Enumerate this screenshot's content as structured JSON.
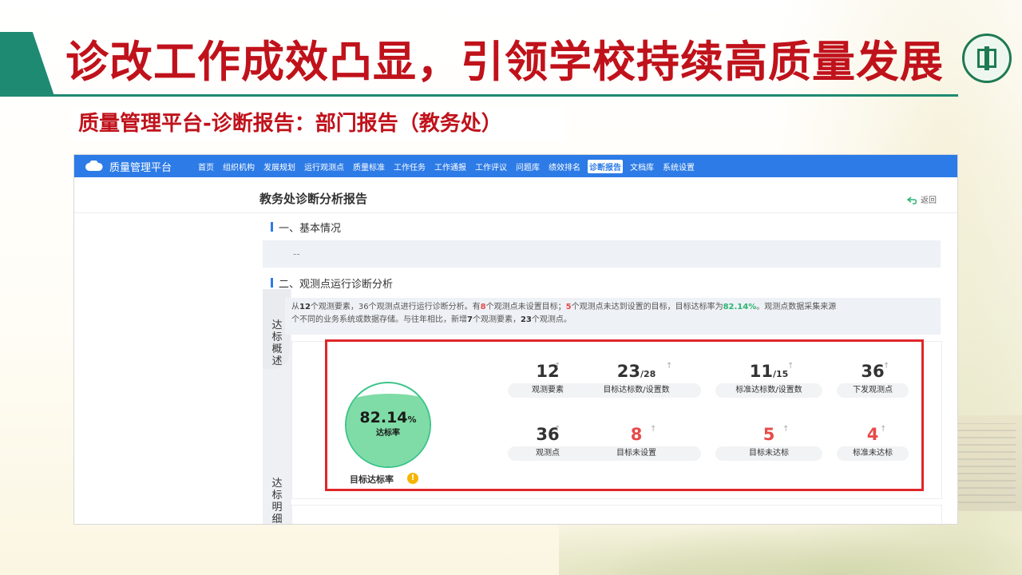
{
  "slide": {
    "title": "诊改工作成效凸显，引领学校持续高质量发展",
    "subtitle": "质量管理平台-诊断报告：部门报告（教务处）"
  },
  "app": {
    "brand": "质量管理平台",
    "nav": [
      "首页",
      "组织机构",
      "发展规划",
      "运行观测点",
      "质量标准",
      "工作任务",
      "工作通报",
      "工作评议",
      "问题库",
      "绩效排名",
      "诊断报告",
      "文档库",
      "系统设置"
    ],
    "active_nav": "诊断报告"
  },
  "report": {
    "title": "教务处诊断分析报告",
    "back_label": "返回",
    "section1_title": "一、基本情况",
    "section1_content": "--",
    "section2_title": "二、观测点运行诊断分析",
    "tab_overview": "达标概述",
    "tab_detail": "达标明细",
    "summary": {
      "p1": "从",
      "elements": "12",
      "p2": "个观测要素，",
      "points": "36",
      "p3": "个观测点进行运行诊断分析。有",
      "unset": "8",
      "p4": "个观测点未设置目标；",
      "unmet": "5",
      "p5": "个观测点未达到设置的目标，目标达标率为",
      "rate": "82.14%",
      "p6": "。观测点数据采集来源",
      "line2a": "个不同的业务系统或数据存储。与往年相比，新增",
      "new_elements": "7",
      "line2b": "个观测要素，",
      "new_points": "23",
      "line2c": "个观测点。"
    }
  },
  "gauge": {
    "value": "82.14",
    "unit": "%",
    "fraction": 0.8214,
    "label": "达标率",
    "caption": "目标达标率",
    "color": "#7fdca6"
  },
  "stats": {
    "s1": {
      "value": "12",
      "label": "观测要素"
    },
    "s2": {
      "value": "23",
      "den": "/28",
      "label": "目标达标数/设置数"
    },
    "s3": {
      "value": "11",
      "den": "/15",
      "label": "标准达标数/设置数"
    },
    "s4": {
      "value": "36",
      "label": "下发观测点"
    },
    "s5": {
      "value": "36",
      "label": "观测点"
    },
    "s6": {
      "value": "8",
      "label": "目标未设置"
    },
    "s7": {
      "value": "5",
      "label": "目标未达标"
    },
    "s8": {
      "value": "4",
      "label": "标准未达标"
    }
  },
  "colors": {
    "title_red": "#c0121b",
    "nav_blue": "#2d7be6",
    "highlight_red": "#e0262b",
    "stat_red": "#e64b4b",
    "accent_green": "#2bb673"
  }
}
